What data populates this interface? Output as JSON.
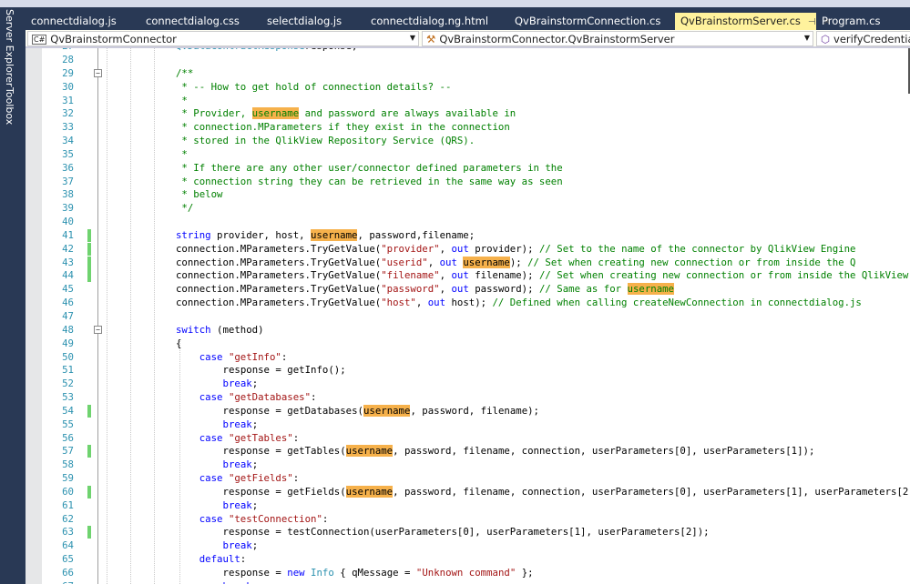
{
  "sidebar": {
    "tabs": [
      "Server Explorer",
      "Toolbox"
    ]
  },
  "tabs": [
    {
      "label": "connectdialog.js",
      "active": false
    },
    {
      "label": "connectdialog.css",
      "active": false
    },
    {
      "label": "selectdialog.js",
      "active": false
    },
    {
      "label": "connectdialog.ng.html",
      "active": false
    },
    {
      "label": "QvBrainstormConnection.cs",
      "active": false
    },
    {
      "label": "QvBrainstormServer.cs",
      "active": true
    },
    {
      "label": "Program.cs",
      "active": false
    }
  ],
  "navbar": {
    "project": "QvBrainstormConnector",
    "class": "QvBrainstormConnector.QvBrainstormServer",
    "member": "verifyCredentials("
  },
  "colors": {
    "keyword": "#0000ff",
    "string": "#a31515",
    "comment": "#008000",
    "type": "#2b91af",
    "highlight": "#f6b14b",
    "changed": "#6fd36f",
    "tab_active": "#fff29d",
    "chrome": "#293955"
  },
  "lines": [
    {
      "n": 27,
      "indent": 0,
      "t": [
        [
          "ty",
          "QvDataContractResponse"
        ],
        [
          "",
          "response;"
        ]
      ]
    },
    {
      "n": 28,
      "indent": 0,
      "t": []
    },
    {
      "n": 29,
      "indent": 0,
      "fold": true,
      "t": [
        [
          "cm",
          "/**"
        ]
      ]
    },
    {
      "n": 30,
      "indent": 0,
      "t": [
        [
          "cm",
          " * -- How to get hold of connection details? --"
        ]
      ]
    },
    {
      "n": 31,
      "indent": 0,
      "t": [
        [
          "cm",
          " *"
        ]
      ]
    },
    {
      "n": 32,
      "indent": 0,
      "t": [
        [
          "cm",
          " * Provider, "
        ],
        [
          "cm hl",
          "username"
        ],
        [
          "cm",
          " and password are always available in"
        ]
      ]
    },
    {
      "n": 33,
      "indent": 0,
      "t": [
        [
          "cm",
          " * connection.MParameters if they exist in the connection"
        ]
      ]
    },
    {
      "n": 34,
      "indent": 0,
      "t": [
        [
          "cm",
          " * stored in the QlikView Repository Service (QRS)."
        ]
      ]
    },
    {
      "n": 35,
      "indent": 0,
      "t": [
        [
          "cm",
          " *"
        ]
      ]
    },
    {
      "n": 36,
      "indent": 0,
      "t": [
        [
          "cm",
          " * If there are any other user/connector defined parameters in the"
        ]
      ]
    },
    {
      "n": 37,
      "indent": 0,
      "t": [
        [
          "cm",
          " * connection string they can be retrieved in the same way as seen"
        ]
      ]
    },
    {
      "n": 38,
      "indent": 0,
      "t": [
        [
          "cm",
          " * below"
        ]
      ]
    },
    {
      "n": 39,
      "indent": 0,
      "t": [
        [
          "cm",
          " */"
        ]
      ]
    },
    {
      "n": 40,
      "indent": 0,
      "t": []
    },
    {
      "n": 41,
      "indent": 0,
      "changed": true,
      "t": [
        [
          "kw",
          "string"
        ],
        [
          "",
          " provider, host, "
        ],
        [
          "hl",
          "username"
        ],
        [
          "",
          ", password,filename;"
        ]
      ]
    },
    {
      "n": 42,
      "indent": 0,
      "changed": true,
      "t": [
        [
          "",
          "connection.MParameters.TryGetValue("
        ],
        [
          "str",
          "\"provider\""
        ],
        [
          "",
          ", "
        ],
        [
          "kw",
          "out"
        ],
        [
          "",
          " provider); "
        ],
        [
          "cm",
          "// Set to the name of the connector by QlikView Engine"
        ]
      ]
    },
    {
      "n": 43,
      "indent": 0,
      "changed": true,
      "t": [
        [
          "",
          "connection.MParameters.TryGetValue("
        ],
        [
          "str",
          "\"userid\""
        ],
        [
          "",
          ", "
        ],
        [
          "kw",
          "out"
        ],
        [
          "",
          " "
        ],
        [
          "hl",
          "username"
        ],
        [
          "",
          "); "
        ],
        [
          "cm",
          "// Set when creating new connection or from inside the Q"
        ]
      ]
    },
    {
      "n": 44,
      "indent": 0,
      "changed": true,
      "t": [
        [
          "",
          "connection.MParameters.TryGetValue("
        ],
        [
          "str",
          "\"filename\""
        ],
        [
          "",
          ", "
        ],
        [
          "kw",
          "out"
        ],
        [
          "",
          " filename); "
        ],
        [
          "cm",
          "// Set when creating new connection or from inside the QlikView"
        ]
      ]
    },
    {
      "n": 45,
      "indent": 0,
      "t": [
        [
          "",
          "connection.MParameters.TryGetValue("
        ],
        [
          "str",
          "\"password\""
        ],
        [
          "",
          ", "
        ],
        [
          "kw",
          "out"
        ],
        [
          "",
          " password); "
        ],
        [
          "cm",
          "// Same as for "
        ],
        [
          "cm hl",
          "username"
        ]
      ]
    },
    {
      "n": 46,
      "indent": 0,
      "t": [
        [
          "",
          "connection.MParameters.TryGetValue("
        ],
        [
          "str",
          "\"host\""
        ],
        [
          "",
          ", "
        ],
        [
          "kw",
          "out"
        ],
        [
          "",
          " host); "
        ],
        [
          "cm",
          "// Defined when calling createNewConnection in connectdialog.js"
        ]
      ]
    },
    {
      "n": 47,
      "indent": 0,
      "t": []
    },
    {
      "n": 48,
      "indent": 0,
      "fold": true,
      "t": [
        [
          "kw",
          "switch"
        ],
        [
          "",
          " (method)"
        ]
      ]
    },
    {
      "n": 49,
      "indent": 0,
      "t": [
        [
          "",
          "{"
        ]
      ]
    },
    {
      "n": 50,
      "indent": 1,
      "t": [
        [
          "kw",
          "case"
        ],
        [
          "",
          " "
        ],
        [
          "str",
          "\"getInfo\""
        ],
        [
          "",
          ":"
        ]
      ]
    },
    {
      "n": 51,
      "indent": 2,
      "t": [
        [
          "",
          "response = getInfo();"
        ]
      ]
    },
    {
      "n": 52,
      "indent": 2,
      "t": [
        [
          "kw",
          "break"
        ],
        [
          "",
          ";"
        ]
      ]
    },
    {
      "n": 53,
      "indent": 1,
      "t": [
        [
          "kw",
          "case"
        ],
        [
          "",
          " "
        ],
        [
          "str",
          "\"getDatabases\""
        ],
        [
          "",
          ":"
        ]
      ]
    },
    {
      "n": 54,
      "indent": 2,
      "changed": true,
      "t": [
        [
          "",
          "response = getDatabases("
        ],
        [
          "hl",
          "username"
        ],
        [
          "",
          ", password, filename);"
        ]
      ]
    },
    {
      "n": 55,
      "indent": 2,
      "t": [
        [
          "kw",
          "break"
        ],
        [
          "",
          ";"
        ]
      ]
    },
    {
      "n": 56,
      "indent": 1,
      "t": [
        [
          "kw",
          "case"
        ],
        [
          "",
          " "
        ],
        [
          "str",
          "\"getTables\""
        ],
        [
          "",
          ":"
        ]
      ]
    },
    {
      "n": 57,
      "indent": 2,
      "changed": true,
      "t": [
        [
          "",
          "response = getTables("
        ],
        [
          "hl",
          "username"
        ],
        [
          "",
          ", password, filename, connection, userParameters[0], userParameters[1]);"
        ]
      ]
    },
    {
      "n": 58,
      "indent": 2,
      "t": [
        [
          "kw",
          "break"
        ],
        [
          "",
          ";"
        ]
      ]
    },
    {
      "n": 59,
      "indent": 1,
      "t": [
        [
          "kw",
          "case"
        ],
        [
          "",
          " "
        ],
        [
          "str",
          "\"getFields\""
        ],
        [
          "",
          ":"
        ]
      ]
    },
    {
      "n": 60,
      "indent": 2,
      "changed": true,
      "t": [
        [
          "",
          "response = getFields("
        ],
        [
          "hl",
          "username"
        ],
        [
          "",
          ", password, filename, connection, userParameters[0], userParameters[1], userParameters[2"
        ]
      ]
    },
    {
      "n": 61,
      "indent": 2,
      "t": [
        [
          "kw",
          "break"
        ],
        [
          "",
          ";"
        ]
      ]
    },
    {
      "n": 62,
      "indent": 1,
      "t": [
        [
          "kw",
          "case"
        ],
        [
          "",
          " "
        ],
        [
          "str",
          "\"testConnection\""
        ],
        [
          "",
          ":"
        ]
      ]
    },
    {
      "n": 63,
      "indent": 2,
      "changed": true,
      "t": [
        [
          "",
          "response = testConnection(userParameters[0], userParameters[1], userParameters[2]);"
        ]
      ]
    },
    {
      "n": 64,
      "indent": 2,
      "t": [
        [
          "kw",
          "break"
        ],
        [
          "",
          ";"
        ]
      ]
    },
    {
      "n": 65,
      "indent": 1,
      "t": [
        [
          "kw",
          "default"
        ],
        [
          "",
          ":"
        ]
      ]
    },
    {
      "n": 66,
      "indent": 2,
      "t": [
        [
          "",
          "response = "
        ],
        [
          "kw",
          "new"
        ],
        [
          "",
          " "
        ],
        [
          "ty",
          "Info"
        ],
        [
          "",
          " { qMessage = "
        ],
        [
          "str",
          "\"Unknown command\""
        ],
        [
          "",
          " };"
        ]
      ]
    },
    {
      "n": 67,
      "indent": 2,
      "t": [
        [
          "kw",
          "break"
        ],
        [
          "",
          ";"
        ]
      ]
    }
  ]
}
